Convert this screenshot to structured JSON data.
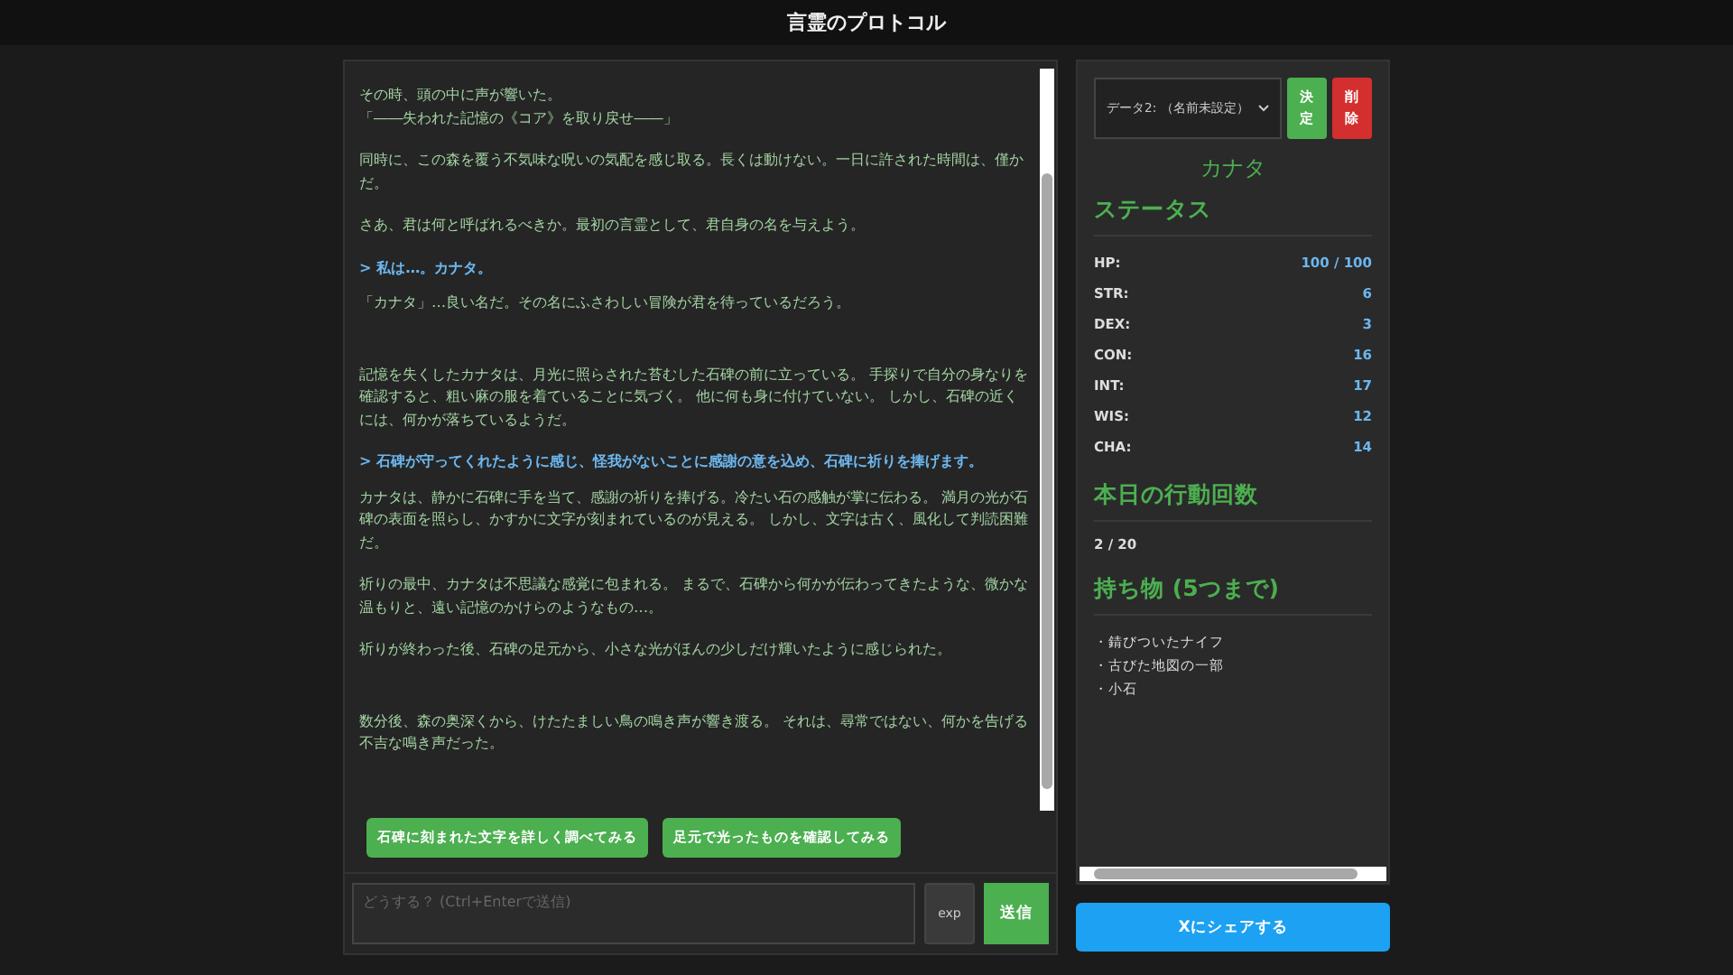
{
  "header": {
    "title": "言霊のプロトコル"
  },
  "story": [
    {
      "kind": "narration",
      "lines": [
        "その時、頭の中に声が響いた。",
        "「――失われた記憶の《コア》を取り戻せ――」"
      ]
    },
    {
      "kind": "narration",
      "text": "同時に、この森を覆う不気味な呪いの気配を感じ取る。長くは動けない。一日に許された時間は、僅かだ。"
    },
    {
      "kind": "narration",
      "text": "さあ、君は何と呼ばれるべきか。最初の言霊として、君自身の名を与えよう。"
    },
    {
      "kind": "player",
      "text": "> 私は…。カナタ。"
    },
    {
      "kind": "narration",
      "text": "「カナタ」…良い名だ。その名にふさわしい冒険が君を待っているだろう。"
    },
    {
      "kind": "break"
    },
    {
      "kind": "narration",
      "text": "記憶を失くしたカナタは、月光に照らされた苔むした石碑の前に立っている。 手探りで自分の身なりを確認すると、粗い麻の服を着ていることに気づく。 他に何も身に付けていない。 しかし、石碑の近くには、何かが落ちているようだ。"
    },
    {
      "kind": "player",
      "text": "> 石碑が守ってくれたように感じ、怪我がないことに感謝の意を込め、石碑に祈りを捧げます。"
    },
    {
      "kind": "narration",
      "text": "カナタは、静かに石碑に手を当て、感謝の祈りを捧げる。冷たい石の感触が掌に伝わる。 満月の光が石碑の表面を照らし、かすかに文字が刻まれているのが見える。 しかし、文字は古く、風化して判読困難だ。"
    },
    {
      "kind": "narration",
      "text": "祈りの最中、カナタは不思議な感覚に包まれる。 まるで、石碑から何かが伝わってきたような、微かな温もりと、遠い記憶のかけらのようなもの…。"
    },
    {
      "kind": "narration",
      "text": "祈りが終わった後、石碑の足元から、小さな光がほんの少しだけ輝いたように感じられた。"
    },
    {
      "kind": "break"
    },
    {
      "kind": "narration",
      "text": "数分後、森の奥深くから、けたたましい鳥の鳴き声が響き渡る。 それは、尋常ではない、何かを告げる不吉な鳴き声だった。"
    }
  ],
  "choices": [
    "石碑に刻まれた文字を詳しく調べてみる",
    "足元で光ったものを確認してみる"
  ],
  "input": {
    "placeholder": "どうする？ (Ctrl+Enterで送信)",
    "exp_button": "exp",
    "send_button": "送信"
  },
  "sidebar": {
    "save_select": "データ2: （名前未設定）",
    "confirm_button": "決定",
    "delete_button": "削除",
    "character_name": "カナタ",
    "status_heading": "ステータス",
    "stats": [
      {
        "label": "HP:",
        "value": "100 / 100"
      },
      {
        "label": "STR:",
        "value": "6"
      },
      {
        "label": "DEX:",
        "value": "3"
      },
      {
        "label": "CON:",
        "value": "16"
      },
      {
        "label": "INT:",
        "value": "17"
      },
      {
        "label": "WIS:",
        "value": "12"
      },
      {
        "label": "CHA:",
        "value": "14"
      }
    ],
    "actions_heading": "本日の行動回数",
    "actions_count": "2 / 20",
    "inventory_heading": "持ち物 (5つまで)",
    "inventory": [
      "・錆びついたナイフ",
      "・古びた地図の一部",
      "・小石"
    ]
  },
  "share_button": "Xにシェアする"
}
